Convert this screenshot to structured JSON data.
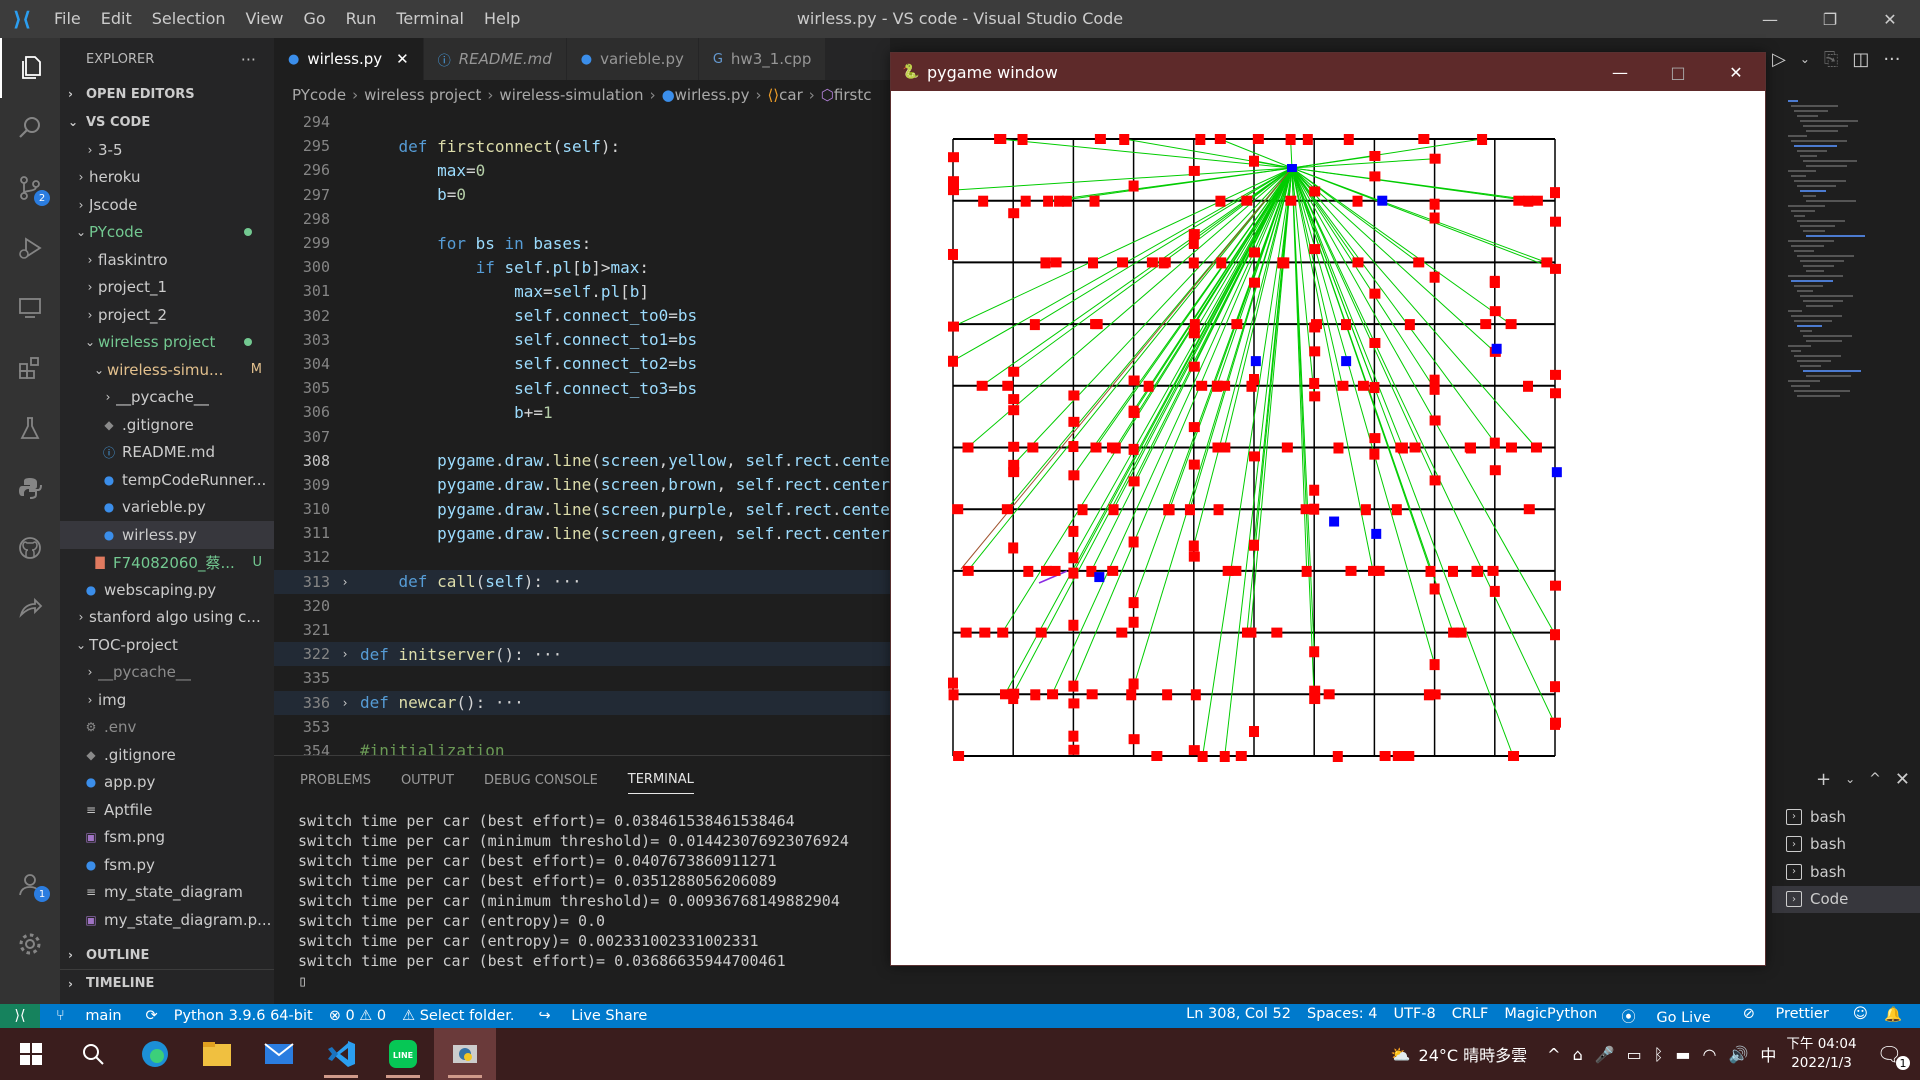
{
  "window": {
    "title": "wirless.py - VS code - Visual Studio Code",
    "menu": [
      "File",
      "Edit",
      "Selection",
      "View",
      "Go",
      "Run",
      "Terminal",
      "Help"
    ],
    "controls": [
      "—",
      "❐",
      "✕"
    ]
  },
  "activity": {
    "source_control_badge": "2",
    "accounts_badge": "1"
  },
  "explorer": {
    "header": "EXPLORER",
    "more": "···",
    "open_editors": "OPEN EDITORS",
    "workspace": "VS CODE",
    "outline": "OUTLINE",
    "timeline": "TIMELINE",
    "tree": [
      {
        "label": "3-5",
        "depth": 2,
        "type": "folder",
        "open": false
      },
      {
        "label": "heroku",
        "depth": 1,
        "type": "folder",
        "open": false
      },
      {
        "label": "Jscode",
        "depth": 1,
        "type": "folder",
        "open": false
      },
      {
        "label": "PYcode",
        "depth": 1,
        "type": "folder",
        "open": true,
        "color": "#73c991",
        "dot": true
      },
      {
        "label": "flaskintro",
        "depth": 2,
        "type": "folder",
        "open": false
      },
      {
        "label": "project_1",
        "depth": 2,
        "type": "folder",
        "open": false
      },
      {
        "label": "project_2",
        "depth": 2,
        "type": "folder",
        "open": false
      },
      {
        "label": "wireless project",
        "depth": 2,
        "type": "folder",
        "open": true,
        "color": "#73c991",
        "dot": true
      },
      {
        "label": "wireless-simu...",
        "depth": 3,
        "type": "folder",
        "open": true,
        "color": "#e2c08d",
        "status": "M"
      },
      {
        "label": "__pycache__",
        "depth": 4,
        "type": "folder",
        "open": false
      },
      {
        "label": ".gitignore",
        "depth": 4,
        "type": "git",
        "icon": "◆"
      },
      {
        "label": "README.md",
        "depth": 4,
        "type": "info",
        "icon": "ⓘ"
      },
      {
        "label": "tempCodeRunner...",
        "depth": 4,
        "type": "py",
        "icon": "●"
      },
      {
        "label": "varieble.py",
        "depth": 4,
        "type": "py",
        "icon": "●"
      },
      {
        "label": "wirless.py",
        "depth": 4,
        "type": "py",
        "icon": "●",
        "selected": true
      },
      {
        "label": "F74082060_蔡...",
        "depth": 3,
        "type": "pdf",
        "icon": "▇",
        "color": "#73c991",
        "status": "U"
      },
      {
        "label": "webscaping.py",
        "depth": 2,
        "type": "py",
        "icon": "●"
      },
      {
        "label": "stanford algo using c...",
        "depth": 1,
        "type": "folder",
        "open": false
      },
      {
        "label": "TOC-project",
        "depth": 1,
        "type": "folder",
        "open": true
      },
      {
        "label": "__pycache__",
        "depth": 2,
        "type": "folder",
        "open": false,
        "color": "#8c8c8c"
      },
      {
        "label": "img",
        "depth": 2,
        "type": "folder",
        "open": false
      },
      {
        "label": ".env",
        "depth": 2,
        "type": "gear",
        "icon": "⚙",
        "color": "#8c8c8c"
      },
      {
        "label": ".gitignore",
        "depth": 2,
        "type": "git",
        "icon": "◆"
      },
      {
        "label": "app.py",
        "depth": 2,
        "type": "py",
        "icon": "●"
      },
      {
        "label": "Aptfile",
        "depth": 2,
        "type": "txt",
        "icon": "≡"
      },
      {
        "label": "fsm.png",
        "depth": 2,
        "type": "img",
        "icon": "▣"
      },
      {
        "label": "fsm.py",
        "depth": 2,
        "type": "py",
        "icon": "●"
      },
      {
        "label": "my_state_diagram",
        "depth": 2,
        "type": "txt",
        "icon": "≡"
      },
      {
        "label": "my_state_diagram.p...",
        "depth": 2,
        "type": "img",
        "icon": "▣"
      }
    ]
  },
  "tabs": [
    {
      "label": "wirless.py",
      "icon": "py",
      "active": true,
      "close": "✕"
    },
    {
      "label": "README.md",
      "icon": "info",
      "italic": true
    },
    {
      "label": "varieble.py",
      "icon": "py"
    },
    {
      "label": "hw3_1.cpp",
      "icon": "cpp"
    }
  ],
  "breadcrumb": [
    "PYcode",
    "wireless project",
    "wireless-simulation",
    "wirless.py",
    "car",
    "firstc"
  ],
  "code": [
    {
      "n": "294",
      "t": ""
    },
    {
      "n": "295",
      "t": "    def firstconnect(self):"
    },
    {
      "n": "296",
      "t": "        max=0"
    },
    {
      "n": "297",
      "t": "        b=0"
    },
    {
      "n": "298",
      "t": ""
    },
    {
      "n": "299",
      "t": "        for bs in bases:"
    },
    {
      "n": "300",
      "t": "            if self.pl[b]>max:"
    },
    {
      "n": "301",
      "t": "                max=self.pl[b]"
    },
    {
      "n": "302",
      "t": "                self.connect_to0=bs"
    },
    {
      "n": "303",
      "t": "                self.connect_to1=bs"
    },
    {
      "n": "304",
      "t": "                self.connect_to2=bs"
    },
    {
      "n": "305",
      "t": "                self.connect_to3=bs"
    },
    {
      "n": "306",
      "t": "                b+=1"
    },
    {
      "n": "307",
      "t": ""
    },
    {
      "n": "308",
      "t": "        pygame.draw.line(screen,yellow, self.rect.center"
    },
    {
      "n": "309",
      "t": "        pygame.draw.line(screen,brown, self.rect.center"
    },
    {
      "n": "310",
      "t": "        pygame.draw.line(screen,purple, self.rect.center"
    },
    {
      "n": "311",
      "t": "        pygame.draw.line(screen,green, self.rect.center"
    },
    {
      "n": "312",
      "t": ""
    },
    {
      "n": "313",
      "t": "    def call(self): ···",
      "fold": true,
      "hl": true
    },
    {
      "n": "320",
      "t": ""
    },
    {
      "n": "321",
      "t": ""
    },
    {
      "n": "322",
      "t": "def initserver(): ···",
      "fold": true,
      "hl": true
    },
    {
      "n": "335",
      "t": ""
    },
    {
      "n": "336",
      "t": "def newcar(): ···",
      "fold": true,
      "hl": true
    },
    {
      "n": "353",
      "t": ""
    },
    {
      "n": "354",
      "t": "#initialization"
    }
  ],
  "panel": {
    "tabs": [
      "PROBLEMS",
      "OUTPUT",
      "DEBUG CONSOLE",
      "TERMINAL"
    ],
    "active": "TERMINAL",
    "terminal_lines": [
      "switch time per car (best effort)= 0.038461538461538464",
      "switch time per car (minimum threshold)= 0.014423076923076924",
      "switch time per car (best effort)= 0.0407673860911271",
      "switch time per car (best effort)= 0.0351288056206089",
      "switch time per car (minimum threshold)= 0.00936768149882904",
      "switch time per car (entropy)= 0.0",
      "switch time per car (entropy)= 0.002331002331002331",
      "switch time per car (best effort)= 0.03686635944700461",
      "▯"
    ],
    "terminals": [
      "bash",
      "bash",
      "bash",
      "Code"
    ],
    "term_actions": [
      "+",
      "⌄",
      "^",
      "✕"
    ]
  },
  "pygame": {
    "title": "pygame window",
    "controls": [
      "—",
      "□",
      "✕"
    ],
    "road_color": "#000000",
    "car_color": "#ff0000",
    "base_color": "#0000ff",
    "link_color": "#00cc00",
    "bases": [
      [
        0.63,
        0.1
      ],
      [
        0.42,
        0.36
      ],
      [
        0.57,
        0.36
      ],
      [
        0.82,
        0.34
      ],
      [
        0.92,
        0.54
      ],
      [
        0.55,
        0.62
      ],
      [
        0.62,
        0.64
      ],
      [
        0.16,
        0.71
      ]
    ],
    "hub": [
      0.48,
      0.06
    ]
  },
  "statusbar": {
    "branch": "main",
    "sync": "⟳",
    "python": "Python 3.9.6 64-bit",
    "problems": "⊗ 0 ⚠ 0",
    "select_folder": "⚠ Select folder.",
    "live_share": "Live Share",
    "position": "Ln 308, Col 52",
    "spaces": "Spaces: 4",
    "encoding": "UTF-8",
    "eol": "CRLF",
    "language": "MagicPython",
    "go_live": "Go Live",
    "prettier": "Prettier"
  },
  "taskbar": {
    "weather": "24°C  晴時多雲",
    "ime": "中",
    "time": "下午 04:04",
    "date": "2022/1/3",
    "notif": "1"
  }
}
